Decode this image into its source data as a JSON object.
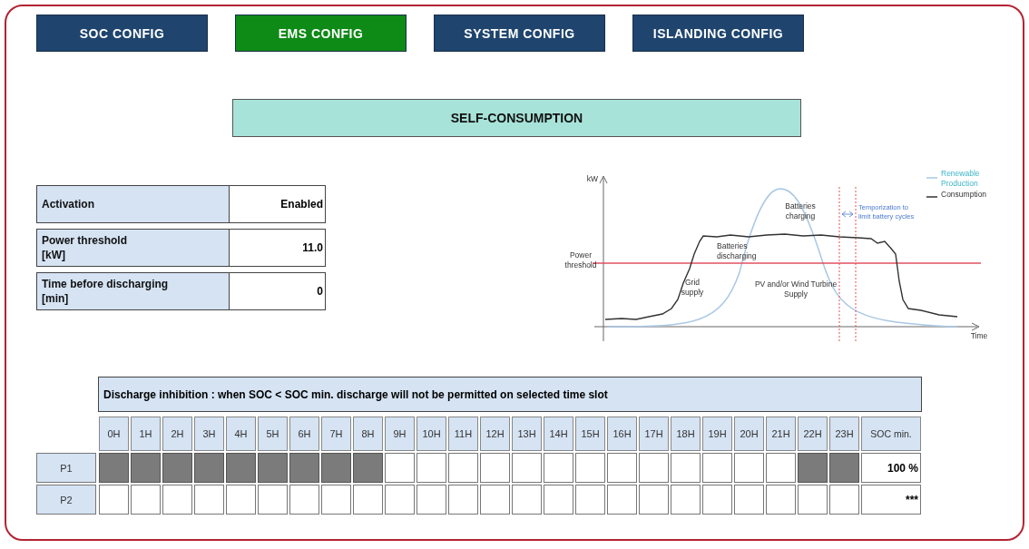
{
  "tabs": [
    {
      "label": "SOC CONFIG",
      "selected": false
    },
    {
      "label": "EMS CONFIG",
      "selected": true
    },
    {
      "label": "SYSTEM CONFIG",
      "selected": false
    },
    {
      "label": "ISLANDING CONFIG",
      "selected": false
    }
  ],
  "section_title": "SELF-CONSUMPTION",
  "settings": [
    {
      "label": "Activation",
      "value": "Enabled"
    },
    {
      "label": "Power threshold",
      "unit": "[kW]",
      "value": "11.0"
    },
    {
      "label": "Time before discharging",
      "unit": "[min]",
      "value": "0"
    }
  ],
  "diagram": {
    "y_axis": "kW",
    "x_axis": "Time",
    "threshold_label": [
      "Power",
      "threshold"
    ],
    "charging_label": [
      "Batteries",
      "charging"
    ],
    "discharging_label": [
      "Batteries",
      "discharging"
    ],
    "grid_label": [
      "Grid",
      "supply"
    ],
    "supply_label": [
      "PV and/or Wind Turbine",
      "Supply"
    ],
    "temporization_label": [
      "Temporization to",
      "limit battery cycles"
    ],
    "legend": [
      {
        "kind": "renewable",
        "label": [
          "Renewable",
          "Production"
        ]
      },
      {
        "kind": "consumption",
        "label": [
          "Consumption"
        ]
      }
    ]
  },
  "schedule": {
    "title": "Discharge inhibition : when SOC < SOC min. discharge will not be permitted on selected time slot",
    "hours": [
      "0H",
      "1H",
      "2H",
      "3H",
      "4H",
      "5H",
      "6H",
      "7H",
      "8H",
      "9H",
      "10H",
      "11H",
      "12H",
      "13H",
      "14H",
      "15H",
      "16H",
      "17H",
      "18H",
      "19H",
      "20H",
      "21H",
      "22H",
      "23H"
    ],
    "soc_header": "SOC min.",
    "rows": [
      {
        "label": "P1",
        "soc_min": "100 %",
        "slots": [
          {
            "selected": true
          },
          {
            "selected": true
          },
          {
            "selected": true
          },
          {
            "selected": true
          },
          {
            "selected": true
          },
          {
            "selected": true
          },
          {
            "selected": true
          },
          {
            "selected": true
          },
          {
            "selected": true
          },
          {
            "selected": false
          },
          {
            "selected": false
          },
          {
            "selected": false
          },
          {
            "selected": false
          },
          {
            "selected": false
          },
          {
            "selected": false
          },
          {
            "selected": false
          },
          {
            "selected": false
          },
          {
            "selected": false
          },
          {
            "selected": false
          },
          {
            "selected": false
          },
          {
            "selected": false
          },
          {
            "selected": false
          },
          {
            "selected": true
          },
          {
            "selected": true
          }
        ]
      },
      {
        "label": "P2",
        "soc_min": "***",
        "slots": [
          {
            "selected": false
          },
          {
            "selected": false
          },
          {
            "selected": false
          },
          {
            "selected": false
          },
          {
            "selected": false
          },
          {
            "selected": false
          },
          {
            "selected": false
          },
          {
            "selected": false
          },
          {
            "selected": false
          },
          {
            "selected": false
          },
          {
            "selected": false
          },
          {
            "selected": false
          },
          {
            "selected": false
          },
          {
            "selected": false
          },
          {
            "selected": false
          },
          {
            "selected": false
          },
          {
            "selected": false
          },
          {
            "selected": false
          },
          {
            "selected": false
          },
          {
            "selected": false
          },
          {
            "selected": false
          },
          {
            "selected": false
          },
          {
            "selected": false
          },
          {
            "selected": false
          }
        ]
      }
    ]
  }
}
